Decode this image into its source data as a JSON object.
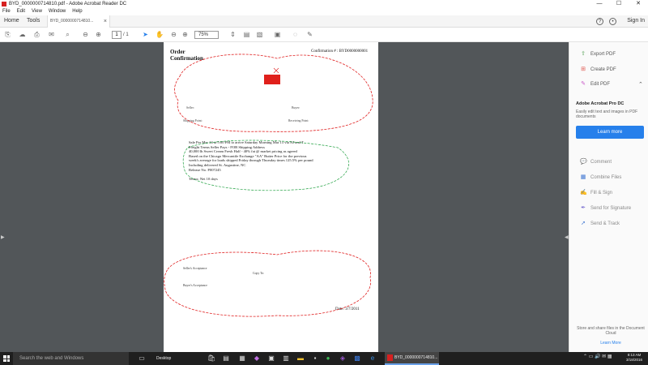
{
  "window": {
    "title": "BYD_0000000714810.pdf - Adobe Acrobat Reader DC",
    "controls": [
      "—",
      "☐",
      "✕"
    ]
  },
  "menu": [
    "File",
    "Edit",
    "View",
    "Window",
    "Help"
  ],
  "tabs": {
    "home": "Home",
    "tools": "Tools",
    "doc_tab": "BYD_0000000714810...",
    "doc_tab_close": "×",
    "sign_in": "Sign In"
  },
  "toolbar": {
    "page_current": "1",
    "page_total": "/ 1",
    "zoom": "75%"
  },
  "document": {
    "title": "Order Confirmation",
    "confirmation_label": "Confirmation # : BYD0000000001",
    "body_lines": [
      "Sale Per Mar 14 at 5:00 PM to arrive Saturday Morning Mar 15 via NJ and T",
      "Freight Terms Seller Pays - FOB Shipping Address",
      "40,000 lb Sweet Cream Fresh Half - 40% fat @ market pricing as agreed",
      "Based on the Chicago Mercantile Exchange \"AA\" Butter Price for the previous",
      "week's average for loads shipped Friday through Thursday times 125.5% per pound",
      "Including delivered St. Augustine, NC",
      "Release No. P007245",
      "",
      "Terms: Net 10 days"
    ],
    "seller_label": "Seller:",
    "buyer_label": "Buyer:",
    "shipping_label": "Shipping Point:",
    "receiving_label": "Receiving Point:",
    "sellers_acceptance": "Seller's Acceptance",
    "buyers_acceptance": "Buyer's Acceptance",
    "copy_to": "Copy To:",
    "date": "Date: 3/7/2011"
  },
  "right_panel": {
    "items": [
      {
        "label": "Export PDF",
        "icon": "export-pdf-icon",
        "color": "#5aa35a"
      },
      {
        "label": "Create PDF",
        "icon": "create-pdf-icon",
        "color": "#e0574f"
      },
      {
        "label": "Edit PDF",
        "icon": "edit-pdf-icon",
        "color": "#c857c8"
      }
    ],
    "promo_title": "Adobe Acrobat Pro DC",
    "promo_desc": "Easily edit text and images in PDF documents",
    "learn_more": "Learn more",
    "tools": [
      {
        "label": "Comment",
        "icon": "comment-icon",
        "color": "#f0b020"
      },
      {
        "label": "Combine Files",
        "icon": "combine-files-icon",
        "color": "#3b73d0"
      },
      {
        "label": "Fill & Sign",
        "icon": "fill-sign-icon",
        "color": "#7a6fd0"
      },
      {
        "label": "Send for Signature",
        "icon": "send-signature-icon",
        "color": "#7a6fd0"
      },
      {
        "label": "Send & Track",
        "icon": "send-track-icon",
        "color": "#3b73d0"
      }
    ],
    "footer_text": "Store and share files in the Document Cloud",
    "footer_link": "Learn More"
  },
  "taskbar": {
    "search_placeholder": "Search the web and Windows",
    "desktop_label": "Desktop",
    "active_app_label": "BYD_0000000714810...",
    "clock_time": "8:13 AM",
    "clock_date": "3/18/2016"
  },
  "colors": {
    "accent": "#2680eb",
    "doc_bg": "#525659",
    "taskbar": "#1f1f1f",
    "annotation_red": "#e02020",
    "annotation_green": "#20a040"
  }
}
